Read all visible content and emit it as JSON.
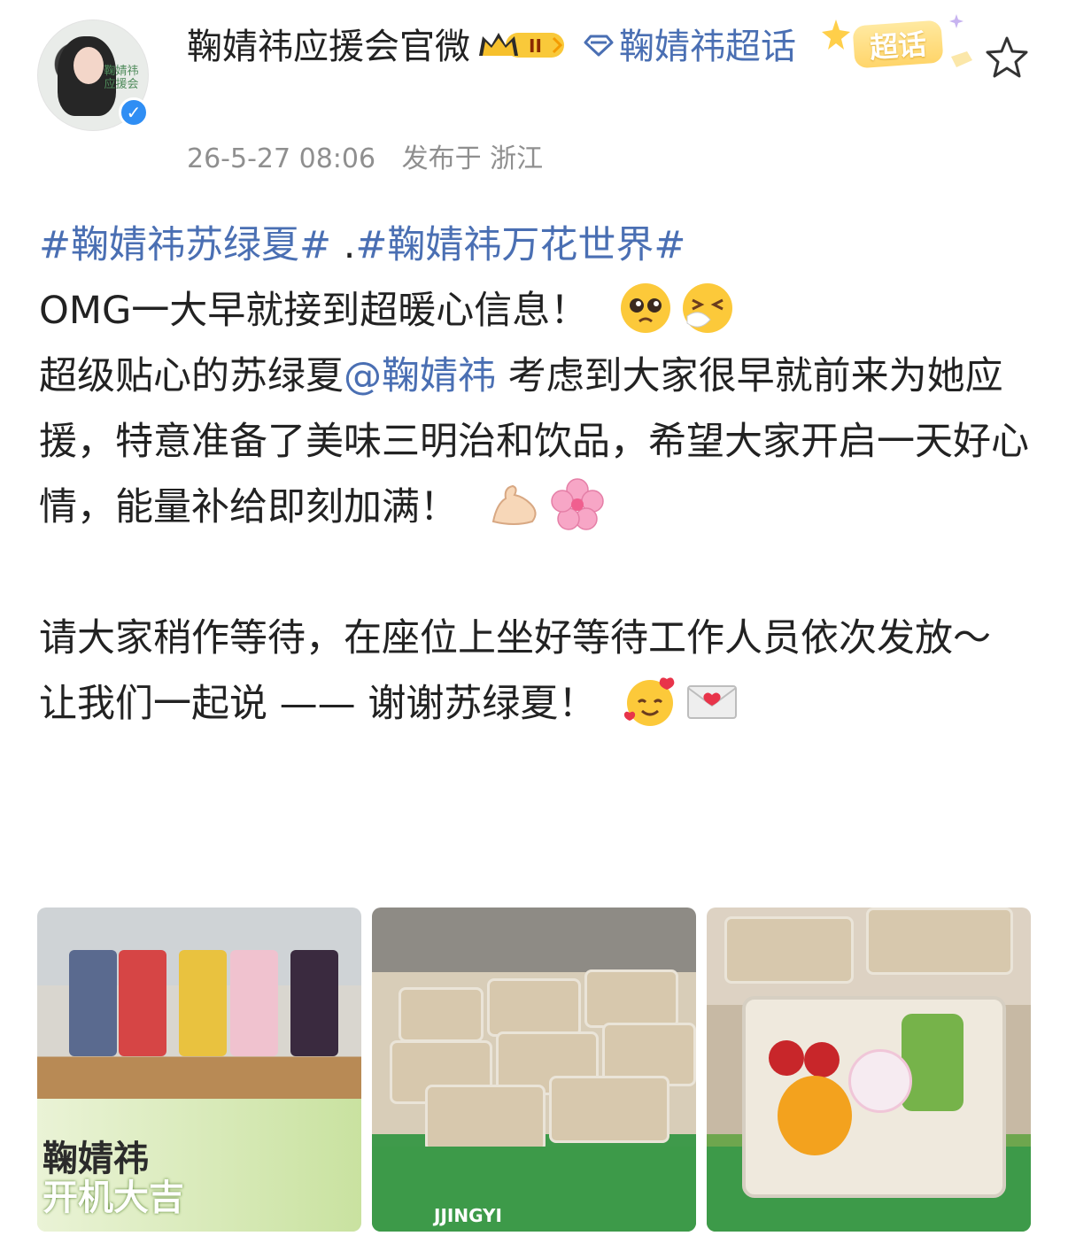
{
  "header": {
    "username": "鞠婧祎应援会官微",
    "level_badge": "II",
    "topic_link": "鞠婧祎超话",
    "topic_badge": "超话",
    "avatar_text": "鞠婧祎 应援会",
    "timestamp": "26-5-27 08:06",
    "location": "发布于 浙江"
  },
  "post": {
    "hashtag1": "#鞠婧祎苏绿夏#",
    "separator": " .",
    "hashtag2": "#鞠婧祎万花世界#",
    "line1": "OMG一大早就接到超暖心信息！",
    "line2_pre": "超级贴心的苏绿夏",
    "mention": "@鞠婧祎",
    "line2_post": " 考虑到大家很早就前来为她应援，特意准备了美味三明治和饮品，希望大家开启一天好心情，能量补给即刻加满！",
    "line3": "请大家稍作等待，在座位上坐好等待工作人员依次发放～",
    "line4": "让我们一起说 —— 谢谢苏绿夏！"
  },
  "photos": {
    "p1_text_top": "鞠婧祎",
    "p1_text_bottom": "开机大吉",
    "p2_text": "JJINGYI"
  },
  "icons": [
    "verified-icon",
    "crown-level-icon",
    "diamond-icon",
    "star-favorite-icon",
    "pleading-face-emoji",
    "sneezing-face-emoji",
    "flexed-biceps-emoji",
    "cherry-blossom-emoji",
    "smiling-hearts-emoji",
    "love-letter-emoji"
  ],
  "colors": {
    "link": "#4a6fb3",
    "verified": "#2f8ef4",
    "meta": "#8f8f8f"
  }
}
